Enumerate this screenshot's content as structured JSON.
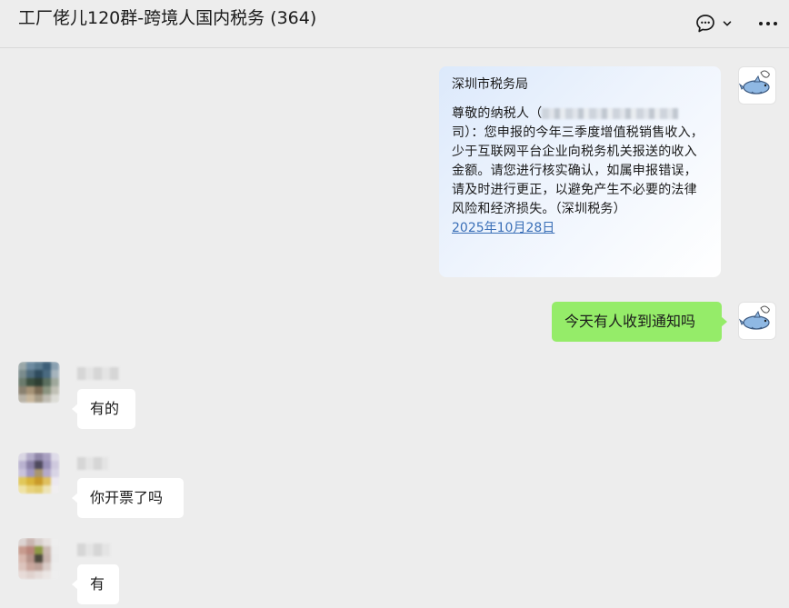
{
  "header": {
    "title": "工厂佬儿120群-跨境人国内税务 (364)",
    "chat_icon": "chat-bubble-icon",
    "chevron_icon": "chevron-down-icon",
    "more_icon": "more-dots-icon"
  },
  "messages": [
    {
      "type": "card",
      "sender_label": "深圳市税务局",
      "body_before": "尊敬的纳税人（",
      "body_after": "司）：您申报的今年三季度增值税销售收入，少于互联网平台企业向税务机关报送的收入金额。请您进行核实确认，如属申报错误，请及时进行更正，以避免产生不必要的法律风险和经济损失。（深圳税务）",
      "date_link": "2025年10月28日"
    },
    {
      "type": "self",
      "text": "今天有人收到通知吗"
    },
    {
      "type": "other",
      "text": "有的"
    },
    {
      "type": "other",
      "text": "你开票了吗"
    },
    {
      "type": "other",
      "text": "有"
    }
  ],
  "colors": {
    "background": "#ededed",
    "self_bubble": "#95ec69",
    "other_bubble": "#ffffff",
    "link": "#3a6fb7"
  }
}
